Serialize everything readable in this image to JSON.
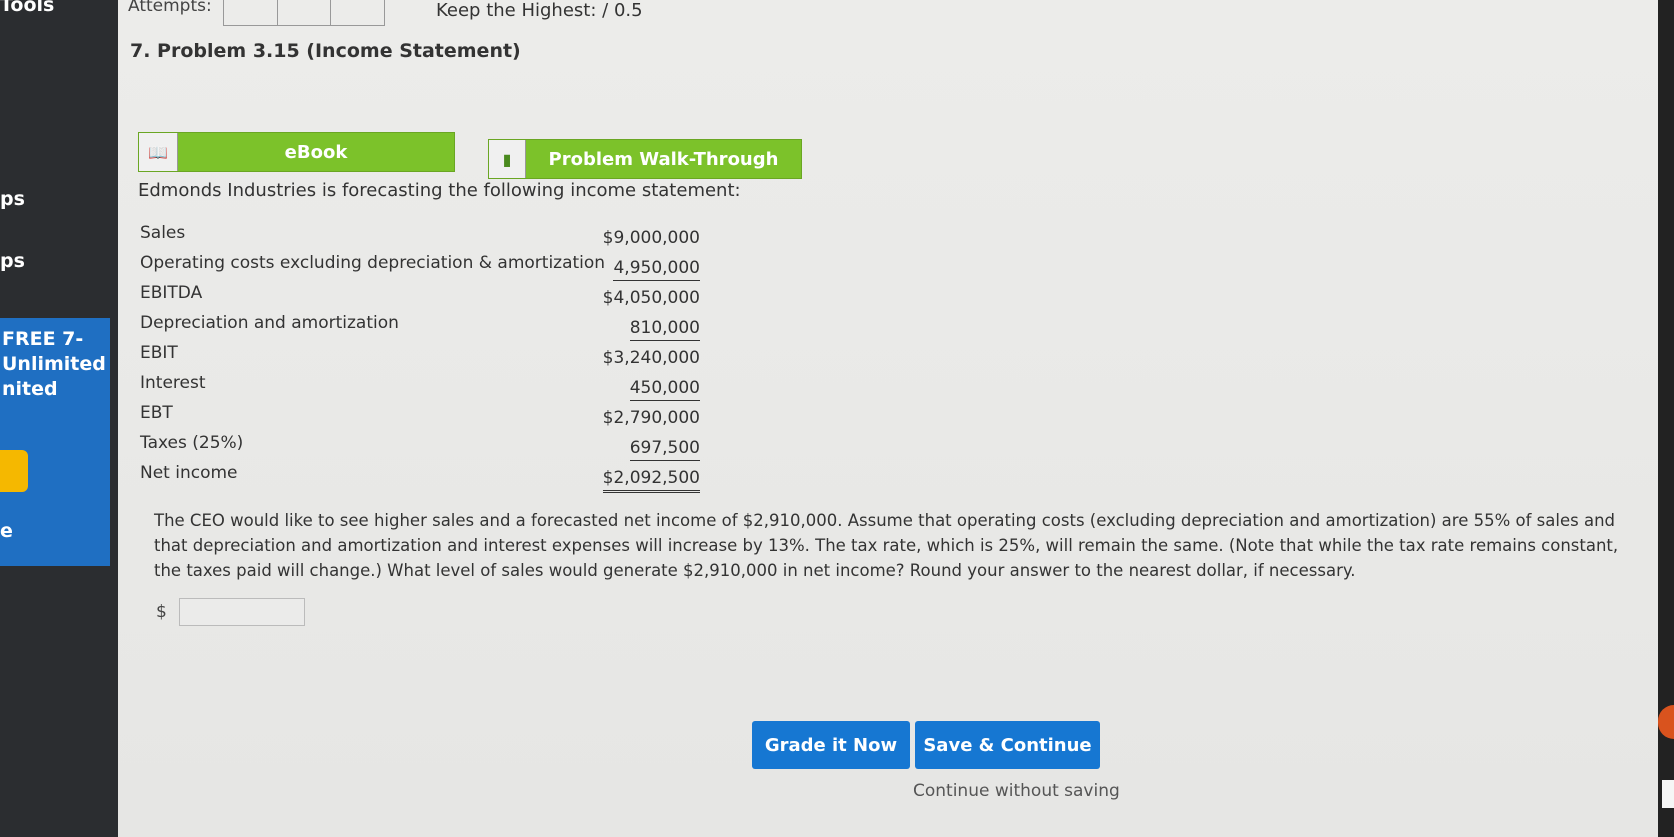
{
  "sidebar": {
    "tools_label": "Tools",
    "items": [
      {
        "label": "ps"
      },
      {
        "label": "ps"
      }
    ],
    "promo": {
      "lines": [
        "FREE 7-",
        "Unlimited",
        "nited"
      ],
      "extra": "e"
    }
  },
  "header": {
    "attempts_label": "Attempts:",
    "keep_highest_label": "Keep the Highest:",
    "keep_highest_value": "/ 0.5"
  },
  "problem": {
    "title": "7. Problem 3.15 (Income Statement)",
    "ebook_label": "eBook",
    "walkthrough_label": "Problem Walk-Through",
    "intro": "Edmonds Industries is forecasting the following income statement:",
    "statement": [
      {
        "label": "Sales",
        "value": "$9,000,000"
      },
      {
        "label": "Operating costs excluding depreciation & amortization",
        "value": "4,950,000"
      },
      {
        "label": "EBITDA",
        "value": "$4,050,000"
      },
      {
        "label": "Depreciation and amortization",
        "value": "810,000"
      },
      {
        "label": "EBIT",
        "value": "$3,240,000"
      },
      {
        "label": "Interest",
        "value": "450,000"
      },
      {
        "label": "EBT",
        "value": "$2,790,000"
      },
      {
        "label": "Taxes (25%)",
        "value": "697,500"
      },
      {
        "label": "Net income",
        "value": "$2,092,500"
      }
    ],
    "question": "The CEO would like to see higher sales and a forecasted net income of $2,910,000. Assume that operating costs (excluding depreciation and amortization) are 55% of sales and that depreciation and amortization and interest expenses will increase by 13%. The tax rate, which is 25%, will remain the same. (Note that while the tax rate remains constant, the taxes paid will change.) What level of sales would generate $2,910,000 in net income? Round your answer to the nearest dollar, if necessary.",
    "answer_prefix": "$",
    "answer_value": ""
  },
  "actions": {
    "grade_label": "Grade it Now",
    "save_label": "Save & Continue",
    "continue_label": "Continue without saving"
  }
}
